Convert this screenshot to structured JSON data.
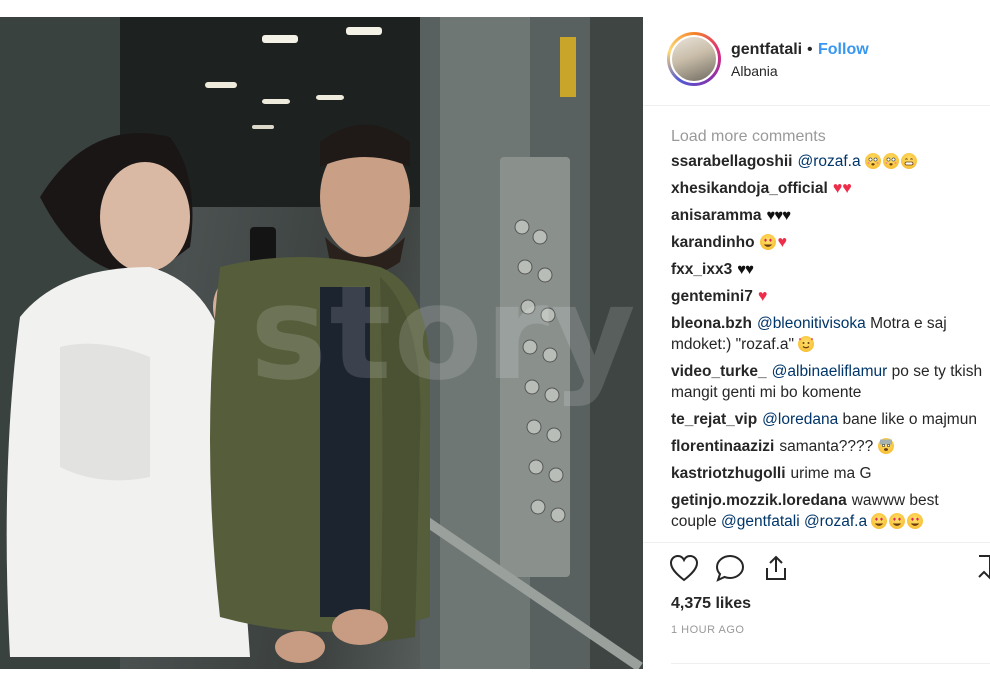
{
  "post": {
    "username": "gentfatali",
    "dot": "•",
    "follow_label": "Follow",
    "location": "Albania",
    "load_more": "Load more comments",
    "likes": "4,375 likes",
    "time": "1 HOUR AGO",
    "watermark": "story"
  },
  "comments": [
    {
      "user": "ssarabellagoshii",
      "mention": "@rozaf.a",
      "text": "",
      "emoji": [
        "emoji-flushed",
        "emoji-flushed",
        "emoji-grin"
      ]
    },
    {
      "user": "xhesikandoja_official",
      "mention": "",
      "text": "",
      "emoji": [
        "red-heart",
        "red-heart"
      ]
    },
    {
      "user": "anisaramma",
      "mention": "",
      "text": "",
      "emoji": [
        "black-heart",
        "black-heart",
        "black-heart"
      ]
    },
    {
      "user": "karandinho",
      "mention": "",
      "text": "",
      "emoji": [
        "heart-eyes",
        "red-heart"
      ]
    },
    {
      "user": "fxx_ixx3",
      "mention": "",
      "text": "",
      "emoji": [
        "black-heart",
        "black-heart"
      ]
    },
    {
      "user": "gentemini7",
      "mention": "",
      "text": "",
      "emoji": [
        "red-heart"
      ]
    },
    {
      "user": "bleona.bzh",
      "mention": "@bleonitivisoka",
      "text": "Motra e saj mdoket:) \"rozaf.a\"",
      "emoji": [
        "smiling-hearts"
      ]
    },
    {
      "user": "video_turke_",
      "mention": "@albinaeliflamur",
      "text": "po se ty tkish mangit genti mi bo komente",
      "emoji": []
    },
    {
      "user": "te_rejat_vip",
      "mention": "@loredana",
      "text": "bane like o majmun",
      "emoji": []
    },
    {
      "user": "florentinaazizi",
      "mention": "",
      "text": "samanta????",
      "emoji": [
        "fearful-face"
      ]
    },
    {
      "user": "kastriotzhugolli",
      "mention": "",
      "text": "urime ma G",
      "emoji": []
    },
    {
      "user": "getinjo.mozzik.loredana",
      "mention": "",
      "text": "wawww best couple",
      "mention2": "@gentfatali @rozaf.a",
      "emoji": [
        "heart-eyes",
        "heart-eyes",
        "heart-eyes"
      ]
    }
  ],
  "icons": {
    "like": "heart-outline-icon",
    "comment": "comment-bubble-icon",
    "share": "share-upload-icon",
    "save": "bookmark-icon"
  },
  "colors": {
    "follow": "#3897f0",
    "muted": "#999999",
    "text": "#262626",
    "heart": "#ed2d4a"
  }
}
